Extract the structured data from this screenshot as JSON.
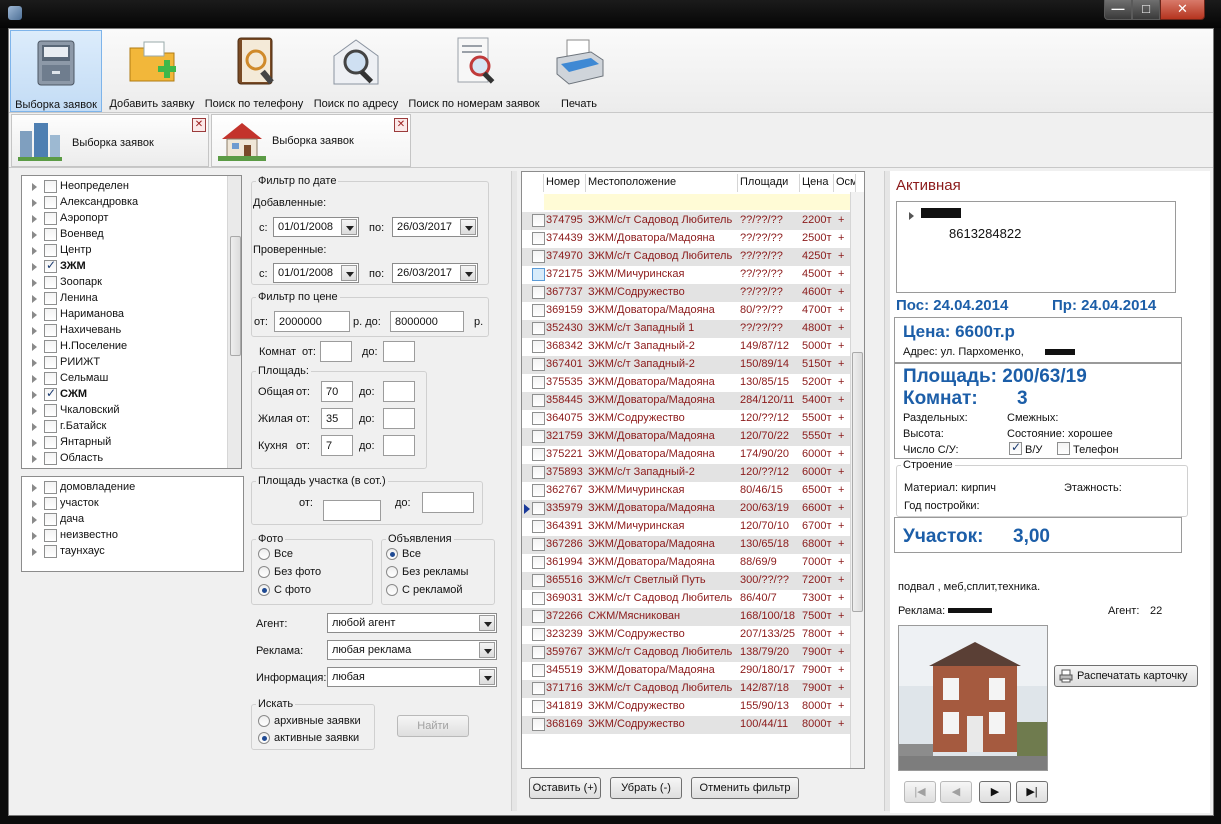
{
  "toolbar": {
    "buttons": [
      {
        "label": "Выборка заявок",
        "icon": "cabinet-icon"
      },
      {
        "label": "Добавить заявку",
        "icon": "folder-add-icon"
      },
      {
        "label": "Поиск по телефону",
        "icon": "phonebook-icon"
      },
      {
        "label": "Поиск по адресу",
        "icon": "envelope-search-icon"
      },
      {
        "label": "Поиск по номерам заявок",
        "icon": "document-search-icon"
      },
      {
        "label": "Печать",
        "icon": "printer-icon"
      }
    ]
  },
  "tabs": [
    {
      "label": "Выборка заявок",
      "icon": "buildings-icon"
    },
    {
      "label": "Выборка заявок",
      "icon": "house-icon"
    }
  ],
  "districts": [
    {
      "label": "Неопределен",
      "checked": false
    },
    {
      "label": "Александровка",
      "checked": false
    },
    {
      "label": "Аэропорт",
      "checked": false
    },
    {
      "label": "Военвед",
      "checked": false
    },
    {
      "label": "Центр",
      "checked": false
    },
    {
      "label": "ЗЖМ",
      "checked": true
    },
    {
      "label": "Зоопарк",
      "checked": false
    },
    {
      "label": "Ленина",
      "checked": false
    },
    {
      "label": "Нариманова",
      "checked": false
    },
    {
      "label": "Нахичевань",
      "checked": false
    },
    {
      "label": "Н.Поселение",
      "checked": false
    },
    {
      "label": "РИИЖТ",
      "checked": false
    },
    {
      "label": "Сельмаш",
      "checked": false
    },
    {
      "label": "СЖМ",
      "checked": true
    },
    {
      "label": "Чкаловский",
      "checked": false
    },
    {
      "label": "г.Батайск",
      "checked": false
    },
    {
      "label": "Янтарный",
      "checked": false
    },
    {
      "label": "Область",
      "checked": false
    }
  ],
  "types": [
    "домовладение",
    "участок",
    "дача",
    "неизвестно",
    "таунхаус"
  ],
  "filters": {
    "date_group": "Фильтр по дате",
    "added_label": "Добавленные:",
    "checked_label": "Проверенные:",
    "from": "с:",
    "to": "по:",
    "added_from": "01/01/2008",
    "added_to": "26/03/2017",
    "checked_from": "01/01/2008",
    "checked_to": "26/03/2017",
    "price_group": "Фильтр по цене",
    "price_from_label": "от:",
    "price_from": "2000000",
    "price_to_label": "р. до:",
    "price_to": "8000000",
    "price_unit": "р.",
    "rooms_label": "Комнат",
    "rooms_from": "от:",
    "rooms_to": "до:",
    "area_group": "Площадь:",
    "area_total": "Общая",
    "area_living": "Жилая",
    "area_kitchen": "Кухня",
    "ot": "от:",
    "do": "до:",
    "area_total_from": "70",
    "area_living_from": "35",
    "area_kitchen_from": "7",
    "plot_group": "Площадь участка (в сот.)",
    "plot_from": "от:",
    "plot_to": "до:",
    "photo_group": "Фото",
    "photo_options": [
      "Все",
      "Без фото",
      "С фото"
    ],
    "photo_selected": 2,
    "ads_group": "Объявления",
    "ads_options": [
      "Все",
      "Без рекламы",
      "С рекламой"
    ],
    "ads_selected": 0,
    "agent_label": "Агент:",
    "agent_value": "любой агент",
    "ad_label": "Реклама:",
    "ad_value": "любая реклама",
    "info_label": "Информация:",
    "info_value": "любая",
    "search_group": "Искать",
    "search_options": [
      "архивные заявки",
      "активные заявки"
    ],
    "search_selected": 1,
    "find_button": "Найти"
  },
  "grid": {
    "headers": [
      "Номер",
      "Местоположение",
      "Площади",
      "Цена",
      "Осм"
    ],
    "rows": [
      {
        "num": "374795",
        "loc": "ЗЖМ/с/т Садовод Любитель",
        "area": "??/??/??",
        "price": "2200т",
        "osm": "+",
        "checked": false
      },
      {
        "num": "374439",
        "loc": "ЗЖМ/Доватора/Мадояна",
        "area": "??/??/??",
        "price": "2500т",
        "osm": "+",
        "checked": false
      },
      {
        "num": "374970",
        "loc": "ЗЖМ/с/т Садовод Любитель",
        "area": "??/??/??",
        "price": "4250т",
        "osm": "+",
        "checked": false
      },
      {
        "num": "372175",
        "loc": "ЗЖМ/Мичуринская",
        "area": "??/??/??",
        "price": "4500т",
        "osm": "+",
        "checked": false,
        "highlight": true
      },
      {
        "num": "367737",
        "loc": "ЗЖМ/Содружество",
        "area": "??/??/??",
        "price": "4600т",
        "osm": "+",
        "checked": false
      },
      {
        "num": "369159",
        "loc": "ЗЖМ/Доватора/Мадояна",
        "area": "80/??/??",
        "price": "4700т",
        "osm": "+",
        "checked": false
      },
      {
        "num": "352430",
        "loc": "ЗЖМ/с/т Западный 1",
        "area": "??/??/??",
        "price": "4800т",
        "osm": "+",
        "checked": false
      },
      {
        "num": "368342",
        "loc": "ЗЖМ/с/т Западный-2",
        "area": "149/87/12",
        "price": "5000т",
        "osm": "+",
        "checked": false
      },
      {
        "num": "367401",
        "loc": "ЗЖМ/с/т Западный-2",
        "area": "150/89/14",
        "price": "5150т",
        "osm": "+",
        "checked": false
      },
      {
        "num": "375535",
        "loc": "ЗЖМ/Доватора/Мадояна",
        "area": "130/85/15",
        "price": "5200т",
        "osm": "+",
        "checked": false
      },
      {
        "num": "358445",
        "loc": "ЗЖМ/Доватора/Мадояна",
        "area": "284/120/11",
        "price": "5400т",
        "osm": "+",
        "checked": false
      },
      {
        "num": "364075",
        "loc": "ЗЖМ/Содружество",
        "area": "120/??/12",
        "price": "5500т",
        "osm": "+",
        "checked": false
      },
      {
        "num": "321759",
        "loc": "ЗЖМ/Доватора/Мадояна",
        "area": "120/70/22",
        "price": "5550т",
        "osm": "+",
        "checked": false
      },
      {
        "num": "375221",
        "loc": "ЗЖМ/Доватора/Мадояна",
        "area": "174/90/20",
        "price": "6000т",
        "osm": "+",
        "checked": false
      },
      {
        "num": "375893",
        "loc": "ЗЖМ/с/т Западный-2",
        "area": "120/??/12",
        "price": "6000т",
        "osm": "+",
        "checked": false
      },
      {
        "num": "362767",
        "loc": "ЗЖМ/Мичуринская",
        "area": "80/46/15",
        "price": "6500т",
        "osm": "+",
        "checked": false
      },
      {
        "num": "335979",
        "loc": "ЗЖМ/Доватора/Мадояна",
        "area": "200/63/19",
        "price": "6600т",
        "osm": "+",
        "checked": false,
        "current": true
      },
      {
        "num": "364391",
        "loc": "ЗЖМ/Мичуринская",
        "area": "120/70/10",
        "price": "6700т",
        "osm": "+",
        "checked": false
      },
      {
        "num": "367286",
        "loc": "ЗЖМ/Доватора/Мадояна",
        "area": "130/65/18",
        "price": "6800т",
        "osm": "+",
        "checked": false
      },
      {
        "num": "361994",
        "loc": "ЗЖМ/Доватора/Мадояна",
        "area": "88/69/9",
        "price": "7000т",
        "osm": "+",
        "checked": false
      },
      {
        "num": "365516",
        "loc": "ЗЖМ/с/т Светлый Путь",
        "area": "300/??/??",
        "price": "7200т",
        "osm": "+",
        "checked": false
      },
      {
        "num": "369031",
        "loc": "ЗЖМ/с/т Садовод Любитель",
        "area": "86/40/7",
        "price": "7300т",
        "osm": "+",
        "checked": false
      },
      {
        "num": "372266",
        "loc": "СЖМ/Мясникован",
        "area": "168/100/18",
        "price": "7500т",
        "osm": "+",
        "checked": false
      },
      {
        "num": "323239",
        "loc": "ЗЖМ/Содружество",
        "area": "207/133/25",
        "price": "7800т",
        "osm": "+",
        "checked": false
      },
      {
        "num": "359767",
        "loc": "ЗЖМ/с/т Садовод Любитель",
        "area": "138/79/20",
        "price": "7900т",
        "osm": "+",
        "checked": false
      },
      {
        "num": "345519",
        "loc": "ЗЖМ/Доватора/Мадояна",
        "area": "290/180/17",
        "price": "7900т",
        "osm": "+",
        "checked": false
      },
      {
        "num": "371716",
        "loc": "ЗЖМ/с/т Садовод Любитель",
        "area": "142/87/18",
        "price": "7900т",
        "osm": "+",
        "checked": false
      },
      {
        "num": "341819",
        "loc": "ЗЖМ/Содружество",
        "area": "155/90/13",
        "price": "8000т",
        "osm": "+",
        "checked": false
      },
      {
        "num": "368169",
        "loc": "ЗЖМ/Содружество",
        "area": "100/44/11",
        "price": "8000т",
        "osm": "+",
        "checked": false
      }
    ],
    "btn_keep": "Оставить (+)",
    "btn_remove": "Убрать (-)",
    "btn_cancel": "Отменить фильтр"
  },
  "card": {
    "status": "Активная",
    "contact_phone": "8613284822",
    "pos": "Пос: 24.04.2014",
    "pr": "Пр: 24.04.2014",
    "price": "Цена: 6600т.р",
    "address": "Адрес:  ул. Пархоменко,",
    "area": "Площадь: 200/63/19",
    "rooms_label": "Комнат:",
    "rooms": "3",
    "separate": "Раздельных:",
    "adjacent": "Смежных:",
    "height": "Высота:",
    "condition": "Состояние:  хорошее",
    "bath_label": "Число С/У:",
    "bath_vu": "В/У",
    "phone_label": "Телефон",
    "building_group": "Строение",
    "material": "Материал:  кирпич",
    "floors": "Этажность:",
    "year": "Год постройки:",
    "plot_label": "Участок:",
    "plot_value": "3,00",
    "description": "подвал , меб,сплит,техника.",
    "ad_label": "Реклама:",
    "agent_label": "Агент:",
    "agent_value": "22",
    "print_card": "Распечатать карточку"
  }
}
